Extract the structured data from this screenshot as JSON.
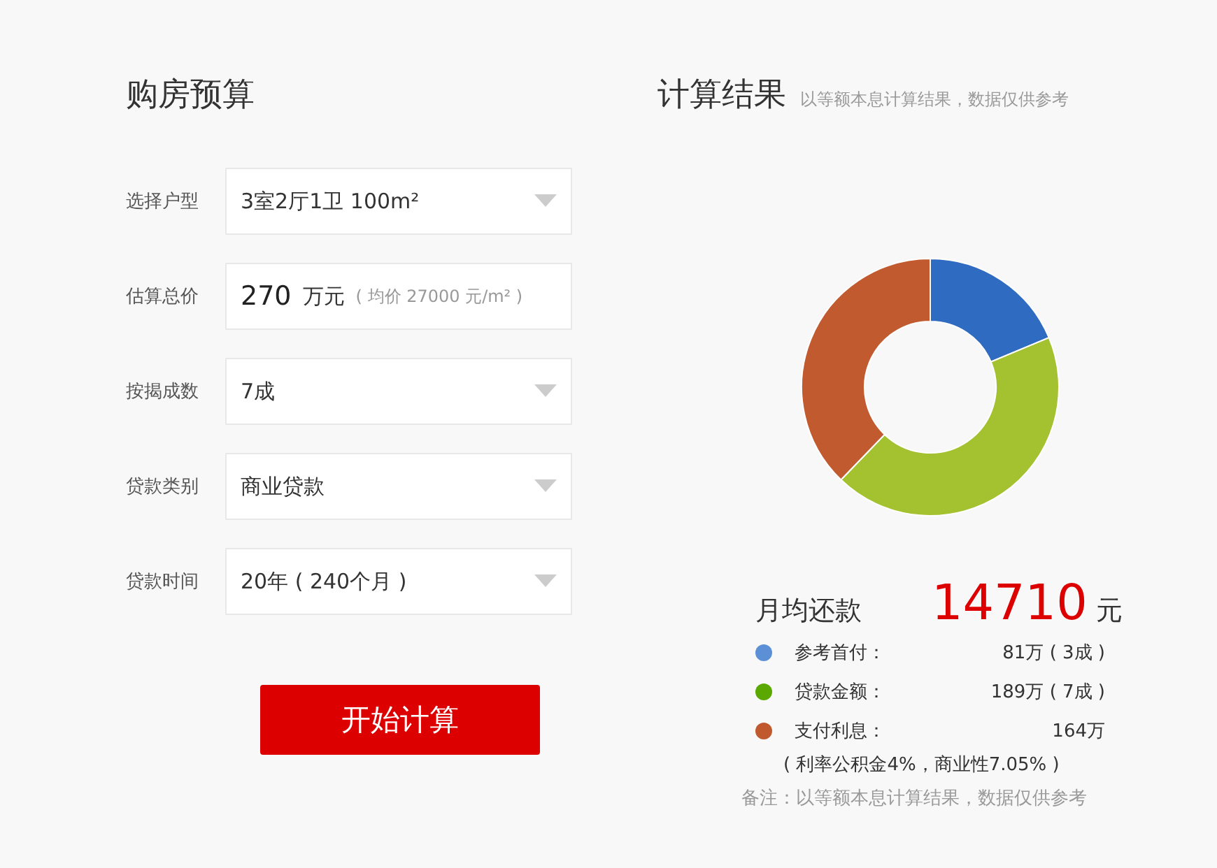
{
  "budget": {
    "title": "购房预算",
    "fields": [
      {
        "kind": "select",
        "label": "选择户型",
        "value": "3室2厅1卫 100m²"
      },
      {
        "kind": "price",
        "label": "估算总价",
        "value": "270",
        "unit": "万元",
        "note": "( 均价 27000 元/m² )"
      },
      {
        "kind": "select",
        "label": "按揭成数",
        "value": "7成"
      },
      {
        "kind": "select",
        "label": "贷款类别",
        "value": "商业贷款"
      },
      {
        "kind": "select",
        "label": "贷款时间",
        "value": "20年 ( 240个月 )"
      }
    ],
    "button": "开始计算"
  },
  "result": {
    "title": "计算结果",
    "subtitle": "以等额本息计算结果，数据仅供参考",
    "chart_data": {
      "type": "donut",
      "values": [
        18.7,
        43.5,
        37.8
      ]
    },
    "monthly_label": "月均还款",
    "monthly_value": "14710",
    "monthly_unit": "元",
    "legend": [
      {
        "label": "参考首付：",
        "value": "81万 ( 3成 )",
        "color": "#5b8fd6"
      },
      {
        "label": "贷款金额：",
        "value": "189万 ( 7成 )",
        "color": "#5aa800"
      },
      {
        "label": "支付利息：",
        "value": "164万",
        "color": "#c05a2e"
      }
    ],
    "rate_note": "( 利率公积金4%，商业性7.05% )",
    "remark": "备注：以等额本息计算结果，数据仅供参考"
  }
}
